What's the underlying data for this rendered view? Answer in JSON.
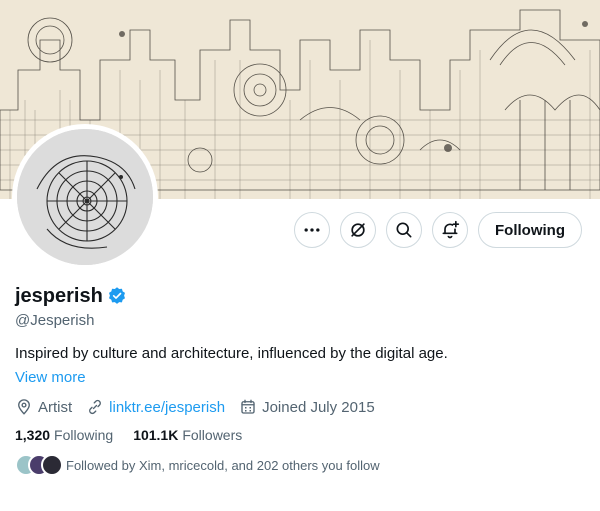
{
  "profile": {
    "display_name": "jesperish",
    "handle": "@Jesperish",
    "bio": "Inspired by culture and architecture, influenced by the digital age.",
    "view_more": "View more",
    "location": "Artist",
    "website": "linktr.ee/jesperish",
    "joined": "Joined July 2015",
    "following_count": "1,320",
    "following_label": "Following",
    "followers_count": "101.1K",
    "followers_label": "Followers",
    "followed_by": "Followed by Xim, mricecold, and 202 others you follow"
  },
  "actions": {
    "more_icon": "more-icon",
    "subscribe_icon": "subscribe-icon",
    "search_icon": "search-icon",
    "notification_icon": "notification-add-icon",
    "follow_label": "Following"
  },
  "colors": {
    "accent": "#1d9bf0",
    "secondary_text": "#536471",
    "primary_text": "#0f1419",
    "border": "#cfd9de",
    "banner_bg": "#efe7d6"
  }
}
